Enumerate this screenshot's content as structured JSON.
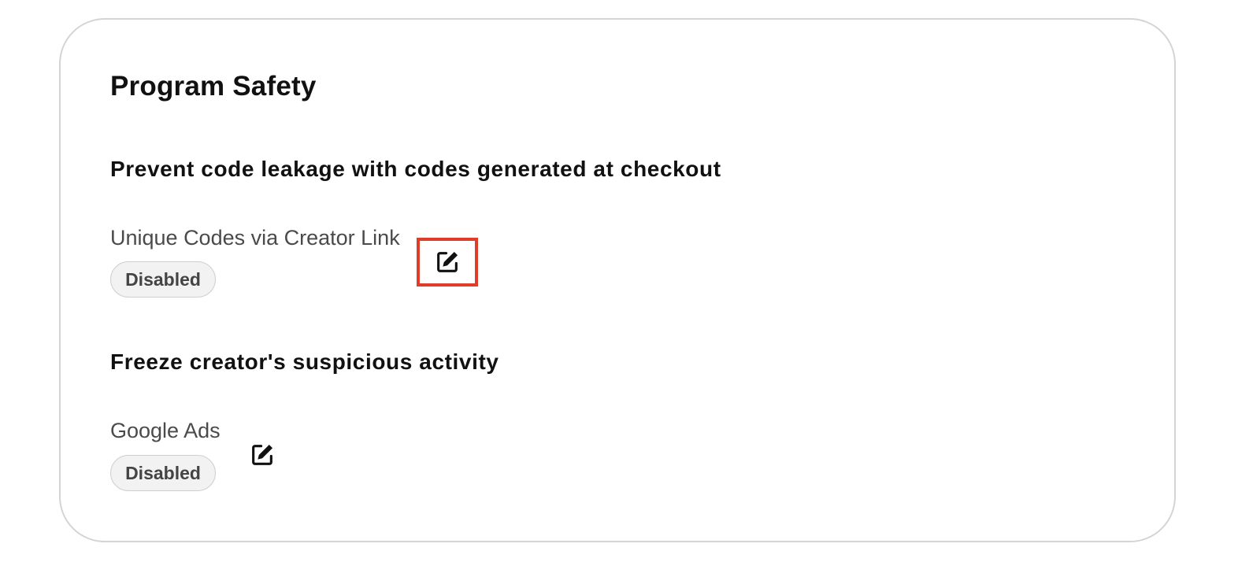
{
  "card": {
    "title": "Program Safety"
  },
  "sections": [
    {
      "heading": "Prevent code leakage with codes generated at checkout",
      "setting": {
        "label": "Unique Codes via Creator Link",
        "status": "Disabled",
        "edit_icon": "edit-icon"
      }
    },
    {
      "heading": "Freeze creator's suspicious activity",
      "setting": {
        "label": "Google Ads",
        "status": "Disabled",
        "edit_icon": "edit-icon"
      }
    }
  ],
  "colors": {
    "card_border": "#d4d4d4",
    "badge_background": "#f2f2f2",
    "badge_text": "#444444",
    "highlight": "#e03c2a"
  }
}
